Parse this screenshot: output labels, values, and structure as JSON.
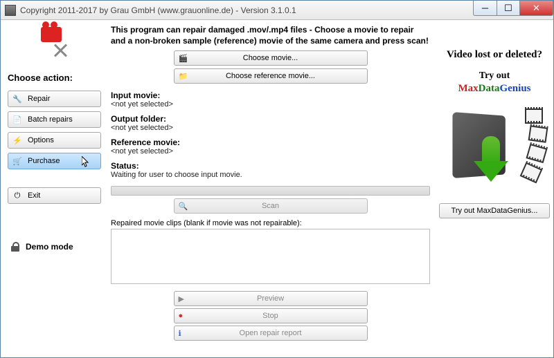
{
  "titlebar": {
    "text": "Copyright 2011-2017 by Grau GmbH (www.grauonline.de) - Version 3.1.0.1"
  },
  "sidebar": {
    "title": "Choose action:",
    "buttons": {
      "repair": "Repair",
      "batch": "Batch repairs",
      "options": "Options",
      "purchase": "Purchase",
      "exit": "Exit"
    },
    "demo": "Demo mode"
  },
  "main": {
    "desc": "This program can repair damaged .mov/.mp4 files - Choose a movie to repair and a non-broken sample (reference) movie of the same camera and press scan!",
    "chooseMovie": "Choose movie...",
    "chooseRef": "Choose reference movie...",
    "inputLabel": "Input movie:",
    "inputVal": "<not yet selected>",
    "outputLabel": "Output folder:",
    "outputVal": "<not yet selected>",
    "refLabel": "Reference movie:",
    "refVal": "<not yet selected>",
    "statusLabel": "Status:",
    "statusVal": "Waiting for user to choose input movie.",
    "scan": "Scan",
    "clipsLabel": "Repaired movie clips (blank if movie was not repairable):",
    "preview": "Preview",
    "stop": "Stop",
    "openReport": "Open repair report"
  },
  "ad": {
    "h1": "Video lost or deleted?",
    "h2": "Try out",
    "brandM": "Max",
    "brandD": "Data",
    "brandG": "Genius",
    "button": "Try out MaxDataGenius..."
  }
}
